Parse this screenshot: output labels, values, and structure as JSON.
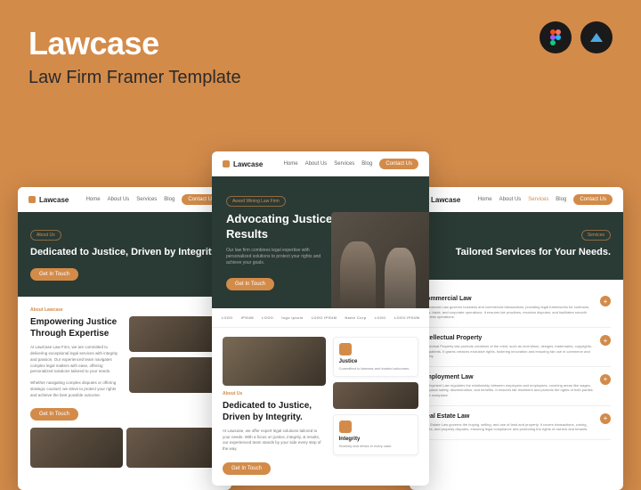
{
  "header": {
    "title": "Lawcase",
    "subtitle": "Law Firm Framer Template"
  },
  "tools": {
    "figma": "figma-icon",
    "framer": "framer-icon"
  },
  "nav": {
    "logo": "Lawcase",
    "links": [
      "Home",
      "About Us",
      "Services",
      "Blog"
    ],
    "cta": "Contact Us"
  },
  "left": {
    "pill": "About Us",
    "title": "Dedicated to Justice, Driven by Integrity.",
    "btn": "Get In Touch",
    "sec_label": "About Lawcase",
    "sec_title": "Empowering Justice Through Expertise",
    "body1": "At LawCase Law Firm, we are committed to delivering exceptional legal services with integrity and passion. Our experienced team navigates complex legal matters with ease, offering personalized solutions tailored to your needs.",
    "body2": "Whether navigating complex disputes or offering strategic counsel, we strive to protect your rights and achieve the best possible outcome."
  },
  "center": {
    "pill": "Award Wining Law Firm",
    "title": "Advocating Justice, Delivering Results",
    "sub": "Our law firm combines legal expertise with personalized solutions to protect your rights and achieve your goals.",
    "btn": "Get In Touch",
    "logos": [
      "LOGO",
      "IPSUM",
      "LOGO",
      "logo ipsum",
      "LOGO IPSUM",
      "Name Corp",
      "LOGO",
      "LOGO IPSUM"
    ],
    "sec_label": "About Us",
    "sec_title": "Dedicated to Justice, Driven by Integrity.",
    "sec_body": "At Lawcase, we offer expert legal solutions tailored to your needs. With a focus on justice, integrity, & results, our experienced team stands by your side every step of the way.",
    "sec_btn": "Get In Touch",
    "features": [
      {
        "title": "Justice",
        "body": "Committed to fairness and trusted outcomes."
      },
      {
        "title": "Integrity",
        "body": "Honesty and ethics in every case."
      }
    ]
  },
  "right": {
    "pill": "Services",
    "title": "Tailored Services for Your Needs.",
    "services": [
      {
        "title": "Commercial Law",
        "body": "Commercial Law governs business and commercial transactions, providing legal frameworks for contracts, sales, trade, and corporate operations. It ensures fair practices, resolves disputes, and facilitates smooth business operations."
      },
      {
        "title": "Intellectual Property",
        "body": "Intellectual Property law protects creations of the mind, such as inventions, designs, trademarks, copyrights, and patents. It grants creators exclusive rights, fostering innovation and ensuring fair use in commerce and society."
      },
      {
        "title": "Employment Law",
        "body": "Employment Law regulates the relationship between employers and employees, covering areas like wages, workplace safety, discrimination, and benefits. It ensures fair treatment and protects the rights of both parties in the workplace."
      },
      {
        "title": "Real Estate Law",
        "body": "Real Estate Law governs the buying, selling, and use of land and property. It covers transactions, zoning, leases, and property disputes, ensuring legal compliance and protecting the rights of owners and tenants."
      }
    ]
  }
}
